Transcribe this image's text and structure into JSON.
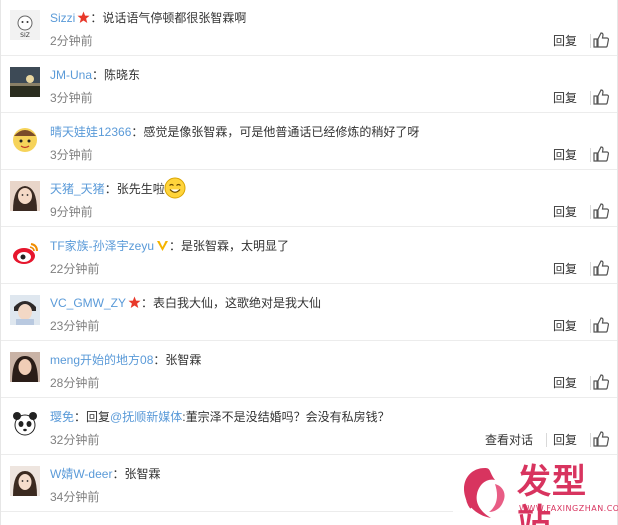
{
  "comments": [
    {
      "username": "Sizzi",
      "badge": "star",
      "text": "说话语气停顿都很张智霖啊",
      "time": "2分钟前",
      "reply": "回复",
      "avatar": "white-avatar"
    },
    {
      "username": "JM-Una",
      "badge": "",
      "text": "陈晓东",
      "time": "3分钟前",
      "reply": "回复",
      "avatar": "landscape-avatar"
    },
    {
      "username": "晴天娃娃12366",
      "badge": "",
      "text": "感觉是像张智霖，可是他普通话已经修炼的稍好了呀",
      "time": "3分钟前",
      "reply": "回复",
      "avatar": "cartoon-avatar"
    },
    {
      "username": "天猪_天猪",
      "badge": "",
      "text": "张先生啦",
      "time": "9分钟前",
      "reply": "回复",
      "avatar": "girl-avatar",
      "emoji": "smile-emoji"
    },
    {
      "username": "TF家族-孙泽宇zeyu",
      "badge": "v",
      "text": "是张智霖，太明显了",
      "time": "22分钟前",
      "reply": "回复",
      "avatar": "weibo-logo-avatar"
    },
    {
      "username": "VC_GMW_ZY",
      "badge": "star",
      "text": "表白我大仙，这歌绝对是我大仙",
      "time": "23分钟前",
      "reply": "回复",
      "avatar": "person-avatar"
    },
    {
      "username": "meng开始的地方08",
      "badge": "",
      "text": "张智霖",
      "time": "28分钟前",
      "reply": "回复",
      "avatar": "woman-avatar"
    },
    {
      "username": "璎免",
      "badge": "",
      "text_prefix": "回复",
      "mention": "@抚顺新媒体",
      "text": "董宗泽不是没结婚吗？会没有私房钱？",
      "time": "32分钟前",
      "reply": "回复",
      "view_conversation": "查看对话",
      "avatar": "panda-avatar"
    },
    {
      "username": "W婧W-deer",
      "badge": "",
      "text": "张智霖",
      "time": "34分钟前",
      "reply": "回复",
      "avatar": "girl2-avatar"
    }
  ],
  "watermark": {
    "title": "发型站",
    "subtitle": "WWW.FAXINGZHAN.COM"
  },
  "colors": {
    "username": "#5a9ad8",
    "time": "#808080",
    "watermark": "#d8345f",
    "star": "#e8382a",
    "vbadge": "#f5b400"
  }
}
